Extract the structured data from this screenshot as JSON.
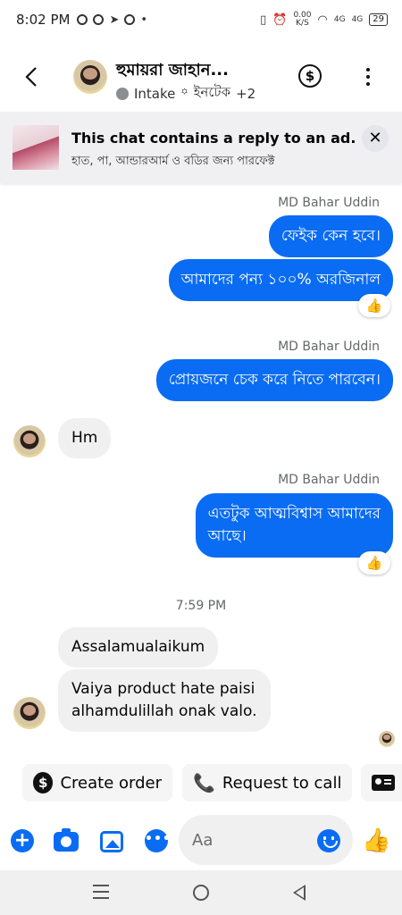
{
  "status_bar": {
    "time": "8:02 PM",
    "network_speed": "0.00",
    "network_unit": "K/S",
    "sig1": "4G",
    "sig2": "4G",
    "battery": "29"
  },
  "header": {
    "contact_name": "হুমায়রা জাহান...",
    "subtitle_label": "Intake",
    "subtitle_separator": "꙳",
    "subtitle_tag": "ইনটেক",
    "subtitle_more": "+2",
    "dollar_symbol": "$"
  },
  "ad_banner": {
    "title": "This chat contains a reply to an ad.",
    "subtitle": "হাত, পা, আন্ডারআর্ম ও বডির জন্য পারফেক্ট",
    "close_symbol": "✕"
  },
  "messages": [
    {
      "direction": "out",
      "sender": "MD Bahar Uddin",
      "text": "ফেইক কেন হবে।"
    },
    {
      "direction": "out",
      "text": "আমাদের পন্য ১০০% অরজিনাল",
      "reaction": "👍"
    },
    {
      "direction": "out",
      "sender": "MD Bahar Uddin",
      "text": "প্রোয়জনে চেক করে নিতে পারবেন।"
    },
    {
      "direction": "in",
      "text": "Hm"
    },
    {
      "direction": "out",
      "sender": "MD Bahar Uddin",
      "line1": "এতটুক আত্মবিশ্বাস আমাদের",
      "line2": "আছে।",
      "reaction": "👍"
    },
    {
      "direction": "in",
      "text": "Assalamualaikum"
    },
    {
      "direction": "in",
      "line1": "Vaiya product hate paisi",
      "line2": "alhamdulillah onak valo."
    }
  ],
  "time_separator": "7:59 PM",
  "quick_actions": {
    "create_order": "Create order",
    "request_call": "Request to call",
    "dollar_symbol": "$",
    "phone_symbol": "📞"
  },
  "composer": {
    "placeholder": "Aa",
    "plus_symbol": "+",
    "chat_symbol": "•••",
    "like_symbol": "👍"
  },
  "colors": {
    "accent": "#0a6cf2",
    "incoming_bubble": "#f0f0f0"
  },
  "icons": [
    "back-icon",
    "dollar-icon",
    "more-icon",
    "close-icon",
    "plus-icon",
    "camera-icon",
    "image-icon",
    "chat-icon",
    "emoji-icon",
    "like-icon",
    "menu-icon",
    "home-icon",
    "nav-back-icon"
  ]
}
